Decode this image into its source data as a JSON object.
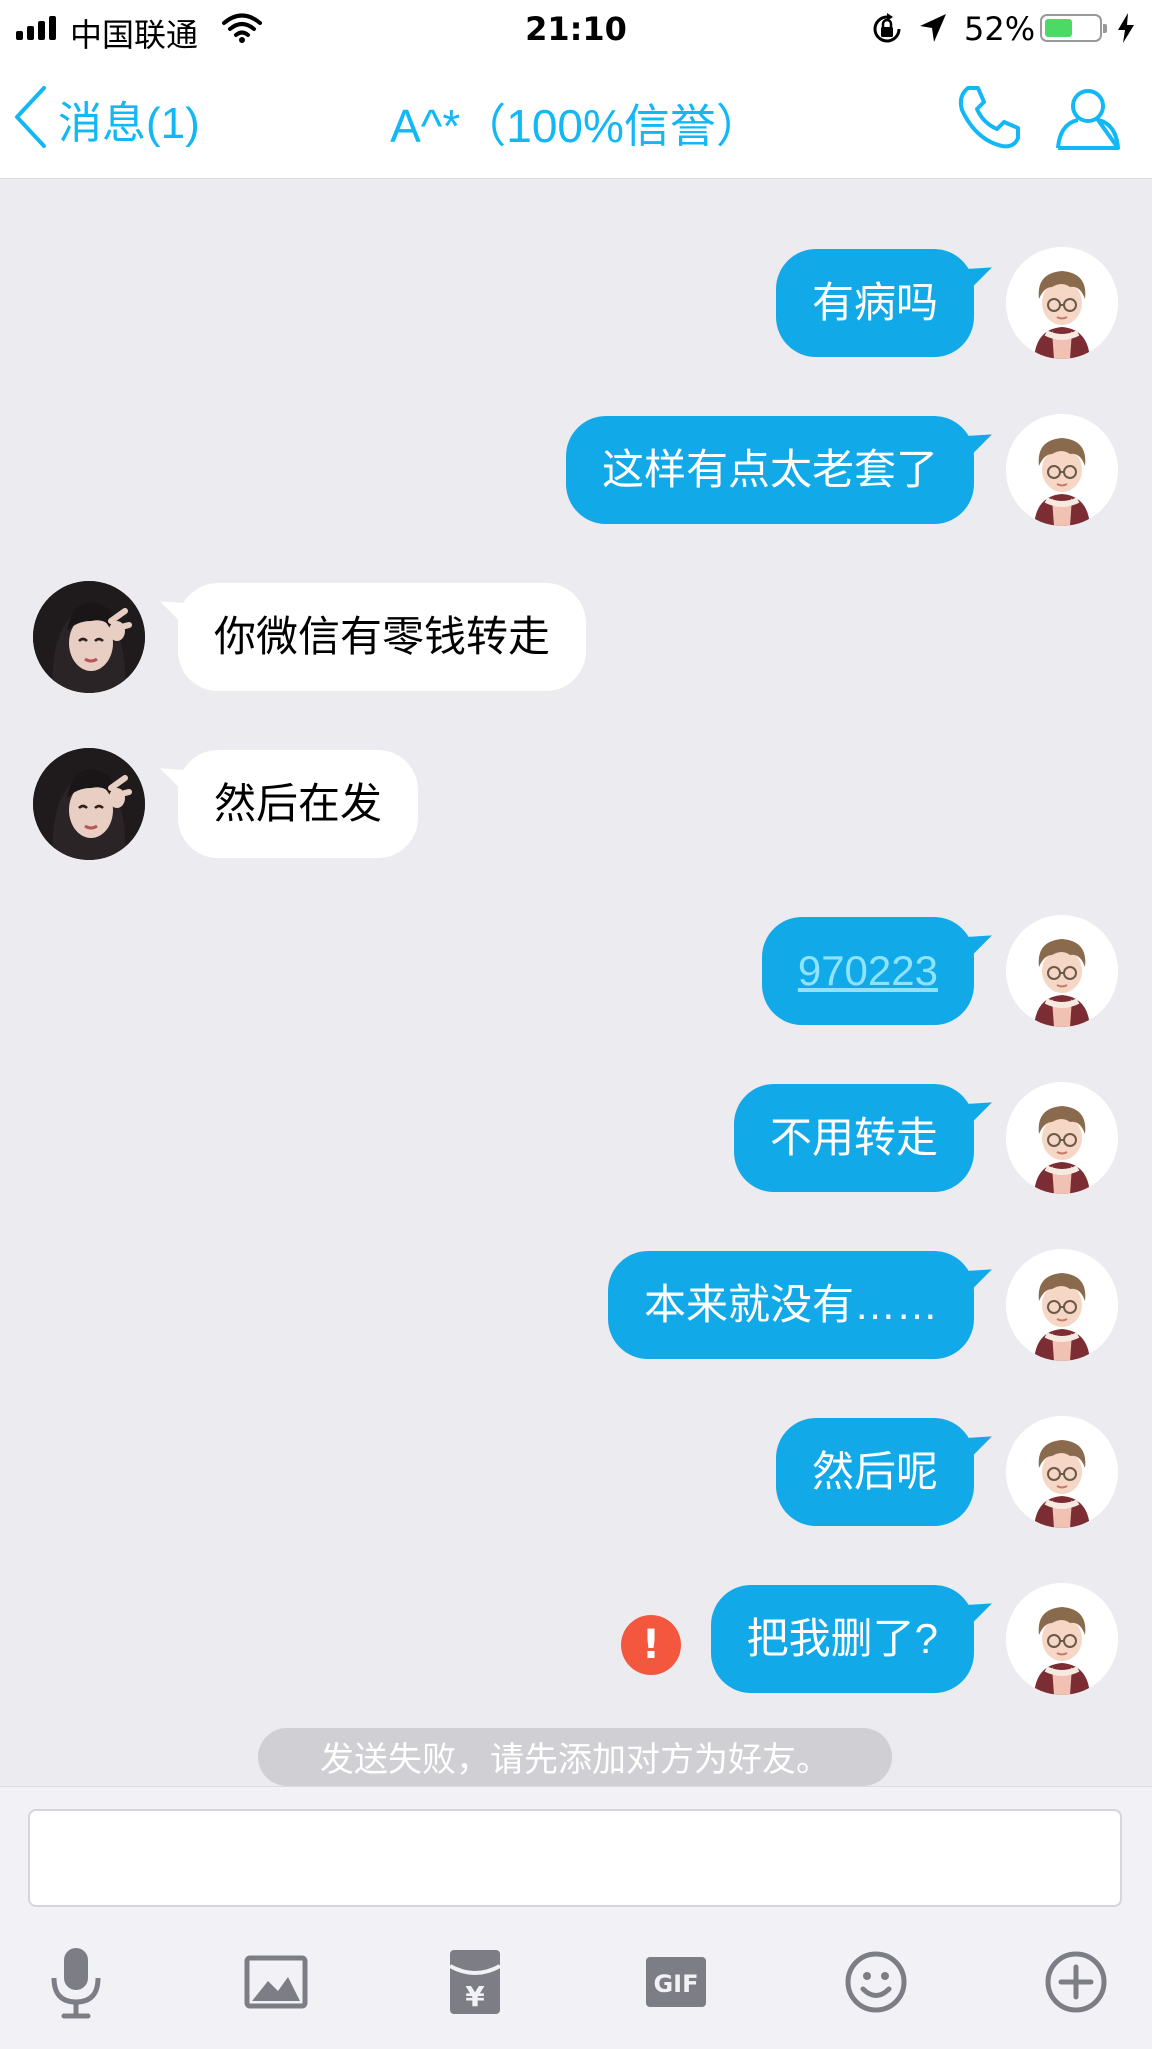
{
  "status_bar": {
    "carrier": "中国联通",
    "time": "21:10",
    "battery_percent": "52%",
    "battery_level": 0.52
  },
  "nav": {
    "back_label": "消息(1)",
    "title": "A^*（100%信誉）"
  },
  "messages": [
    {
      "side": "out",
      "text": "有病吗"
    },
    {
      "side": "out",
      "text": "这样有点太老套了"
    },
    {
      "side": "in",
      "text": "你微信有零钱转走"
    },
    {
      "side": "in",
      "text": "然后在发"
    },
    {
      "side": "out",
      "text": "970223",
      "is_link": true
    },
    {
      "side": "out",
      "text": "不用转走"
    },
    {
      "side": "out",
      "text": "本来就没有……"
    },
    {
      "side": "out",
      "text": "然后呢"
    },
    {
      "side": "out",
      "text": "把我删了?",
      "failed": true
    }
  ],
  "fail_icon_glyph": "!",
  "system_notice": "发送失败，请先添加对方为好友。",
  "input": {
    "value": "",
    "placeholder": ""
  },
  "toolbar": {
    "icons": [
      "microphone-icon",
      "image-icon",
      "red-packet-icon",
      "gif-icon",
      "emoji-icon",
      "plus-icon"
    ],
    "gif_label": "GIF",
    "red_packet_glyph": "¥"
  },
  "colors": {
    "accent": "#12b7f5",
    "bubble_out": "#12a9e9",
    "bubble_in": "#ffffff",
    "background": "#ebebf0",
    "fail": "#f3583f",
    "battery_fill": "#4cd964"
  }
}
